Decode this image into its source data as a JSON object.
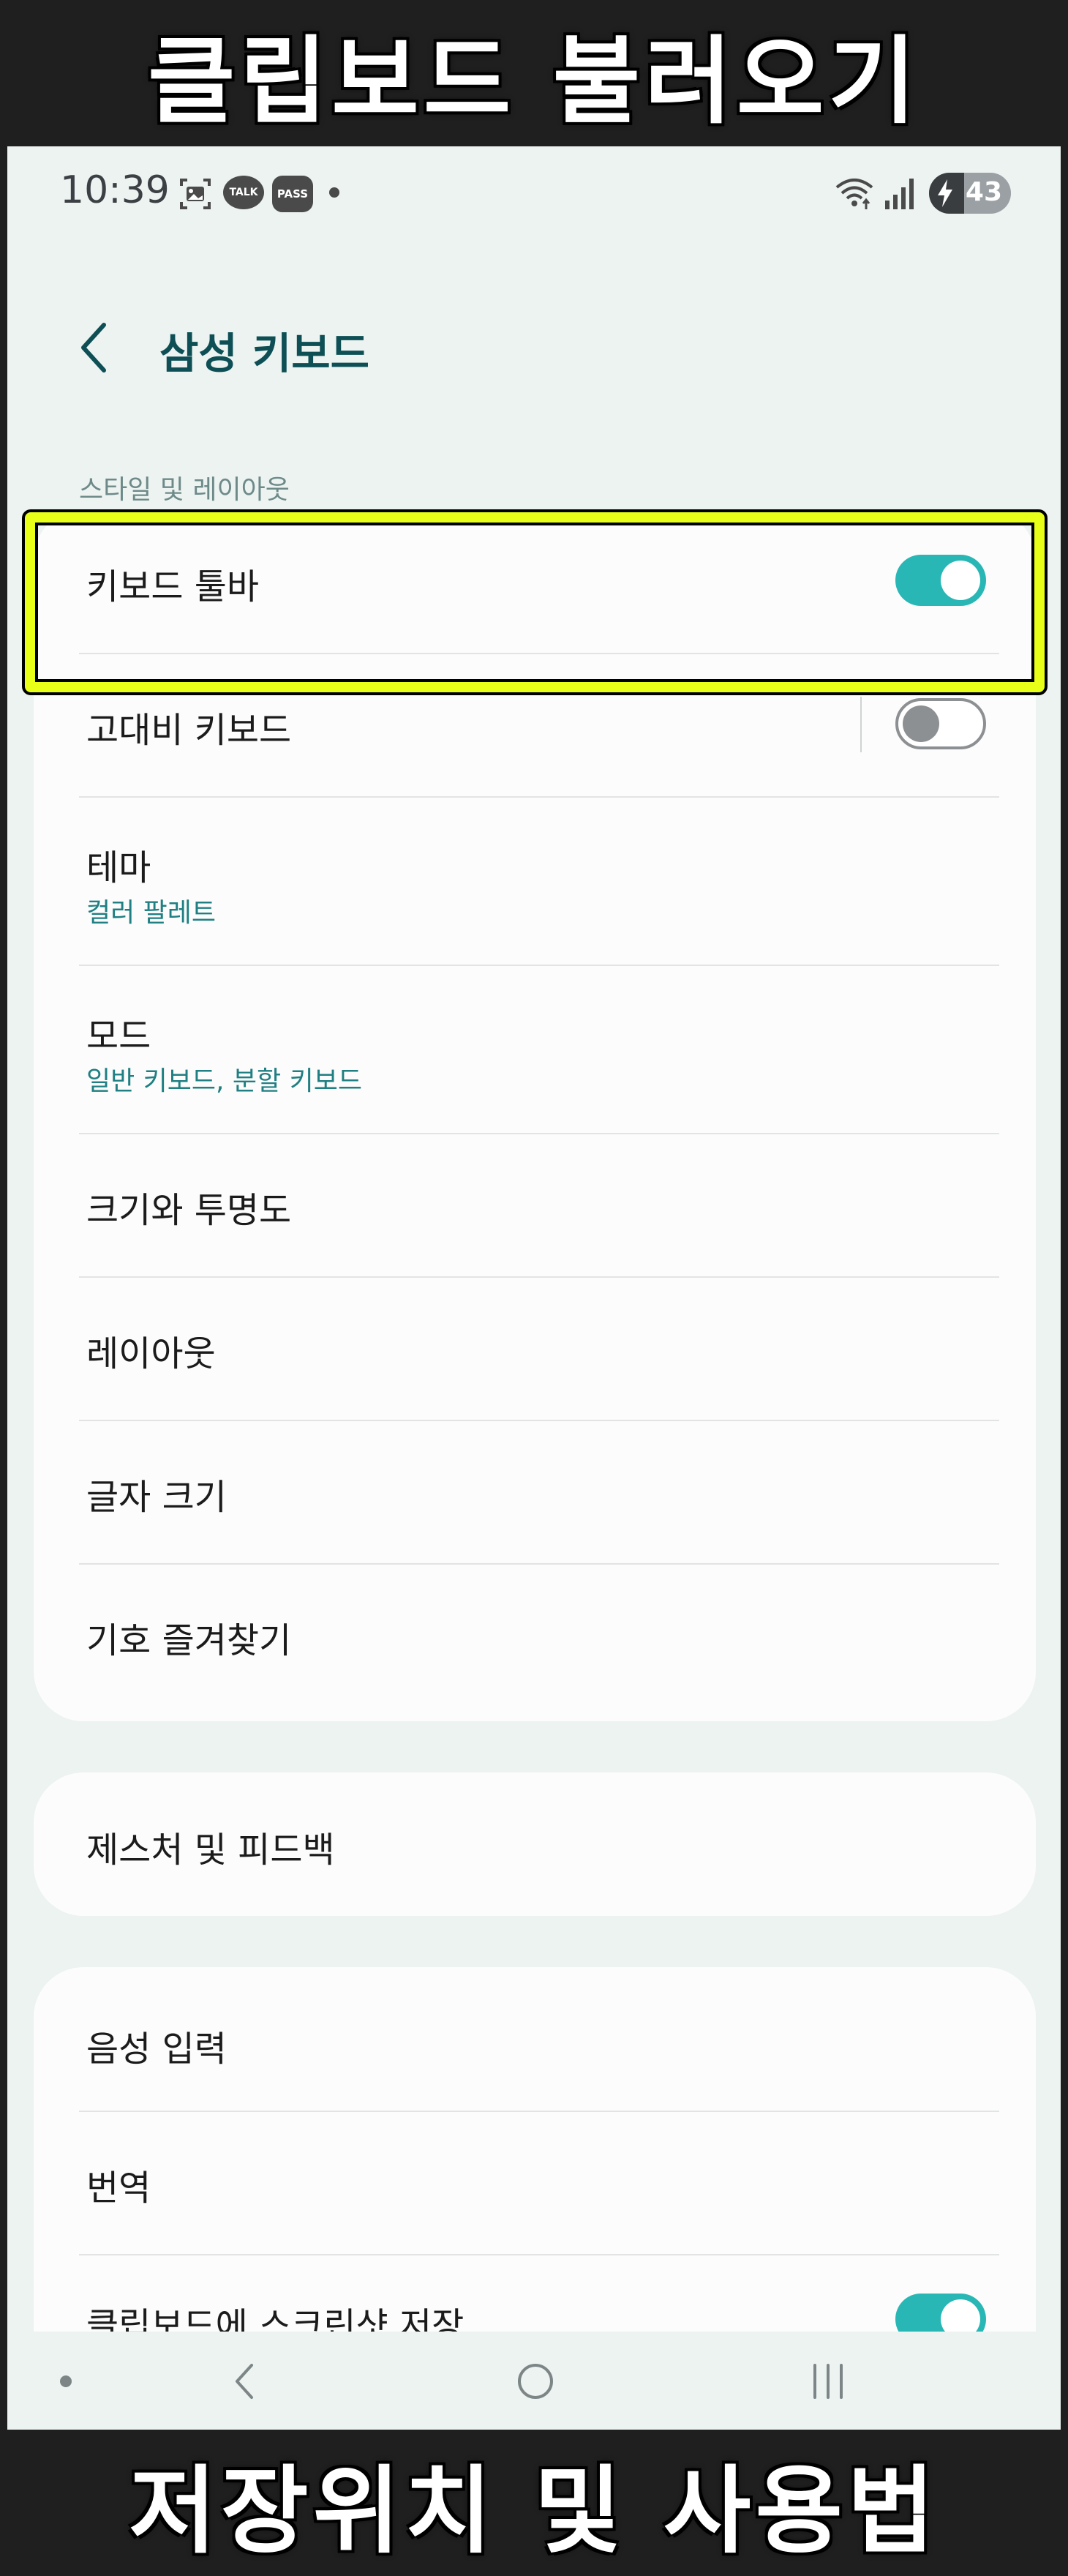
{
  "banner": {
    "top_text": "클립보드 불러오기",
    "bottom_text": "저장위치 및 사용법"
  },
  "status_bar": {
    "time": "10:39",
    "talk_badge": "TALK",
    "pass_badge": "PASS",
    "battery_level": "43",
    "battery_fraction": 0.43
  },
  "header": {
    "title": "삼성 키보드"
  },
  "section": {
    "style_layout": "스타일 및 레이아웃"
  },
  "settings": {
    "toolbar": {
      "title": "키보드 툴바",
      "toggle": "on"
    },
    "high_contrast": {
      "title": "고대비 키보드",
      "toggle": "off"
    },
    "theme": {
      "title": "테마",
      "subtitle": "컬러 팔레트"
    },
    "mode": {
      "title": "모드",
      "subtitle": "일반 키보드, 분할 키보드"
    },
    "size": {
      "title": "크기와 투명도"
    },
    "layout": {
      "title": "레이아웃"
    },
    "font_size": {
      "title": "글자 크기"
    },
    "symbols": {
      "title": "기호 즐겨찾기"
    },
    "gesture": {
      "title": "제스처 및 피드백"
    },
    "voice": {
      "title": "음성 입력"
    },
    "translate": {
      "title": "번역"
    },
    "clipboard": {
      "title": "클립보드에 스크린샷 저장",
      "toggle": "on"
    }
  },
  "colors": {
    "accent": "#28b7b5",
    "title": "#0d4f55",
    "highlight": "#e8ff17"
  },
  "icons": [
    "gallery-icon",
    "wifi-icon",
    "signal-icon",
    "battery-bolt-icon",
    "back-arrow-icon",
    "nav-back-icon",
    "nav-home-icon",
    "nav-recent-icon"
  ]
}
